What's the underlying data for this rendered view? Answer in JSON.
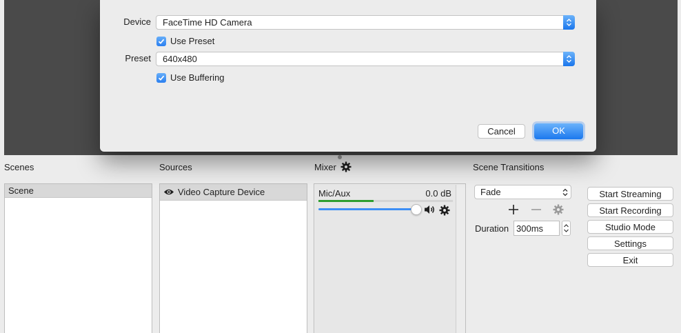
{
  "dialog": {
    "device_label": "Device",
    "device_value": "FaceTime HD Camera",
    "use_preset_label": "Use Preset",
    "use_preset_checked": true,
    "preset_label": "Preset",
    "preset_value": "640x480",
    "use_buffering_label": "Use Buffering",
    "use_buffering_checked": true,
    "cancel_label": "Cancel",
    "ok_label": "OK"
  },
  "docks": {
    "scenes_title": "Scenes",
    "sources_title": "Sources",
    "mixer_title": "Mixer",
    "transitions_title": "Scene Transitions"
  },
  "scenes": {
    "items": [
      "Scene"
    ]
  },
  "sources": {
    "items": [
      {
        "label": "Video Capture Device",
        "visible": true
      }
    ]
  },
  "mixer": {
    "channel_name": "Mic/Aux",
    "level": "0.0 dB",
    "meter_fraction": 0.41,
    "volume_fraction": 1.0
  },
  "transitions": {
    "selected": "Fade",
    "duration_label": "Duration",
    "duration_value": "300ms"
  },
  "controls": {
    "start_streaming": "Start Streaming",
    "start_recording": "Start Recording",
    "studio_mode": "Studio Mode",
    "settings": "Settings",
    "exit": "Exit"
  },
  "colors": {
    "accent": "#1b78ee",
    "meter_green": "#2e9e2e",
    "preview_bg": "#4a4a4a"
  }
}
